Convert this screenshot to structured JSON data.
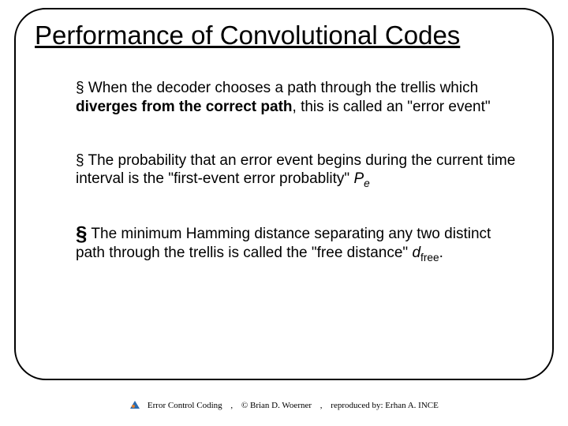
{
  "title": "Performance of Convolutional Codes",
  "bullets": {
    "b1": {
      "marker": "§",
      "pre": " When the decoder chooses a path through the trellis which ",
      "bold": "diverges from the correct path",
      "post": ", this is called an \"error event\""
    },
    "b2": {
      "marker": "§",
      "pre": " The probability that an error event begins during the current time interval is the \"first-event error probablity\" ",
      "var": "P",
      "sub": "e"
    },
    "b3": {
      "marker": "§",
      "pre": "The minimum Hamming distance separating any two distinct path through the trellis is called the \"free distance\" ",
      "var": "d",
      "sub": "free",
      "post": "."
    }
  },
  "footer": {
    "a": "Error Control Coding",
    "b": "© Brian D. Woerner",
    "c": "reproduced by:   Erhan A. INCE",
    "sep": ","
  }
}
